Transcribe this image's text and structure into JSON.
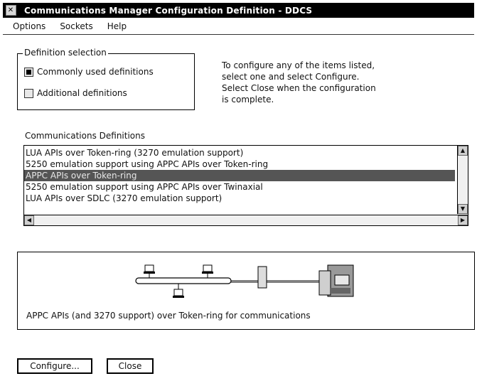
{
  "window": {
    "title": "Communications Manager Configuration Definition - DDCS"
  },
  "menu": [
    {
      "label": "Options"
    },
    {
      "label": "Sockets"
    },
    {
      "label": "Help"
    }
  ],
  "definition_selection": {
    "label": "Definition selection",
    "options": [
      {
        "label": "Commonly used definitions",
        "selected": true
      },
      {
        "label": "Additional definitions",
        "selected": false
      }
    ]
  },
  "info": {
    "text": "To configure any of the items listed,\nselect one and select Configure.\nSelect Close when the configuration\nis complete."
  },
  "definitions": {
    "label": "Communications Definitions",
    "items": [
      "LUA APIs over Token-ring (3270 emulation support)",
      "5250 emulation support using APPC APIs over Token-ring",
      "APPC APIs over Token-ring",
      "5250 emulation support using APPC APIs over Twinaxial",
      "LUA APIs over SDLC (3270 emulation support)"
    ],
    "selected_index": 2
  },
  "description": {
    "text": "APPC APIs (and 3270 support) over Token-ring for communications"
  },
  "buttons": {
    "configure": "Configure...",
    "close": "Close"
  }
}
